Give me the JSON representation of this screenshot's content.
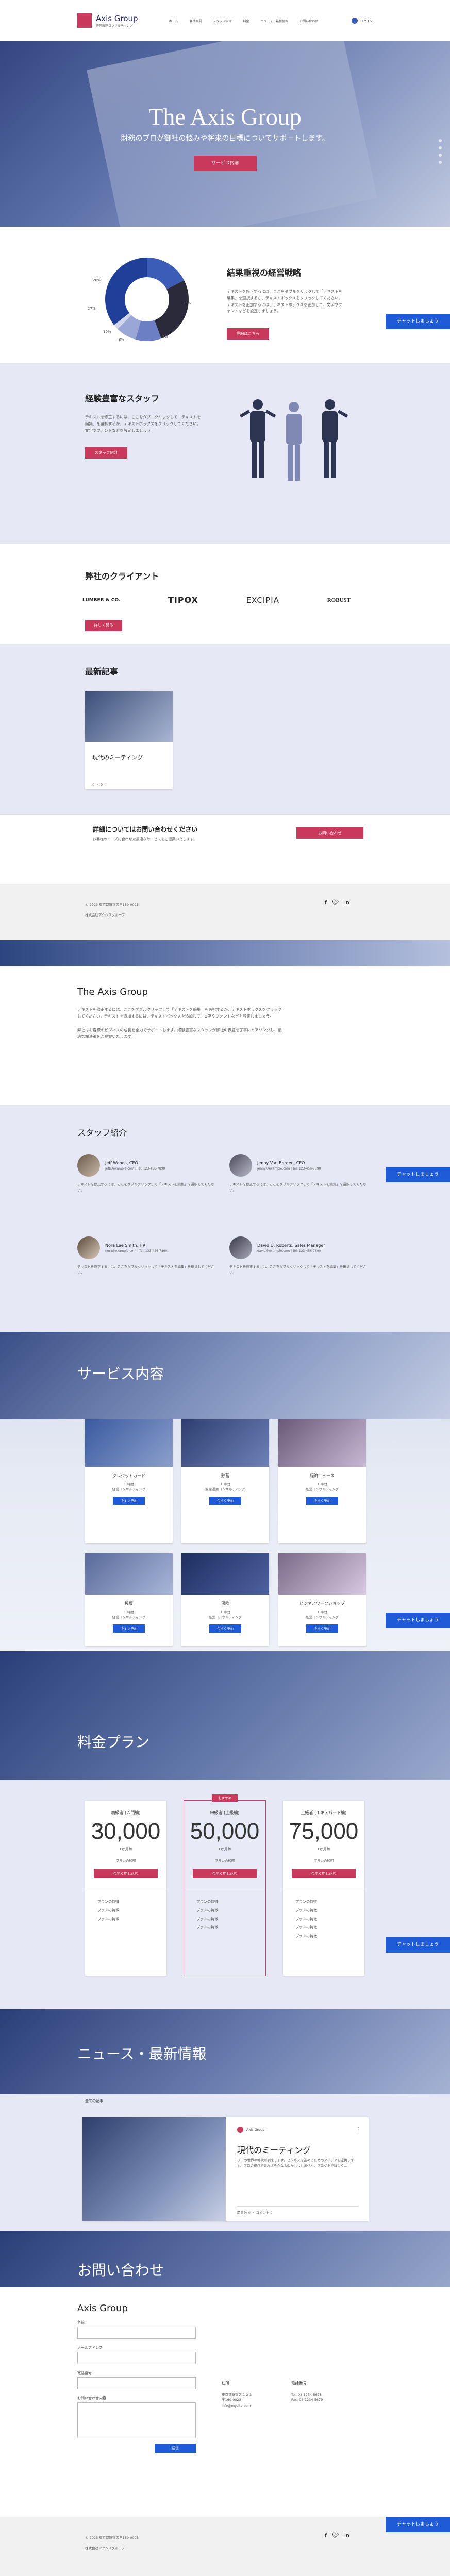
{
  "header": {
    "logo_text": "Axis Group",
    "logo_sub": "経営戦略コンサルティング",
    "nav": [
      "ホーム",
      "会社概要",
      "スタッフ紹介",
      "料金",
      "ニュース・最新情報",
      "お問い合わせ"
    ],
    "login_label": "ログイン"
  },
  "hero": {
    "title": "The Axis Group",
    "subtitle": "財務のプロが御社の悩みや将来の目標についてサポートします。",
    "button": "サービス内容"
  },
  "chat_button": "チャットしましょう",
  "strategy": {
    "title": "結果重視の経営戦略",
    "body": "テキストを修正するには、ここをダブルクリックして「テキストを編集」を選択するか、テキストボックスをクリックしてください。テキストを追加するには、テキストボックスを追加して、文字やフォントなどを設定しましょう。",
    "button": "詳細はこちら",
    "chart_labels": [
      "28%",
      "27%",
      "10%",
      "8%",
      "2%",
      "25%"
    ]
  },
  "staff": {
    "title": "経験豊富なスタッフ",
    "body": "テキストを修正するには、ここをダブルクリックして「テキストを編集」を選択するか、テキストボックスをクリックしてください。文字やフォントなどを設定しましょう。",
    "button": "スタッフ紹介"
  },
  "clients": {
    "title": "弊社のクライアント",
    "logos": [
      "LUMBER & CO.",
      "TIPOX",
      "EXCIPIA",
      "ROBUST"
    ],
    "button": "詳しく見る"
  },
  "news": {
    "title": "最新記事",
    "post_title": "現代のミーティング",
    "post_meta": "0 ・ 0 ♡"
  },
  "contact_band": {
    "title": "詳細についてはお問い合わせください",
    "body": "お客様のニーズに合わせた最適なサービスをご提案いたします。",
    "button": "お問い合わせ"
  },
  "footer1": {
    "copyright": "© 2023 東京都新宿区〒160-0023",
    "note": "株式会社アクシスグループ"
  },
  "about": {
    "title": "The Axis Group",
    "para1": "テキストを修正するには、ここをダブルクリックして「テキストを編集」を選択するか、テキストボックスをクリックしてください。テキストを追加するには、テキストボックスを追加して、文字やフォントなどを設定しましょう。",
    "para2": "弊社はお客様のビジネスの成長を全力でサポートします。経験豊富なスタッフが御社の課題を丁寧にヒアリングし、最適な解決策をご提案いたします。"
  },
  "team": {
    "title": "スタッフ紹介",
    "members": [
      {
        "name": "Jeff Woods, CEO",
        "contact": "jeff@example.com | Tel: 123-456-7890",
        "bio": "テキストを修正するには、ここをダブルクリックして「テキストを編集」を選択してください。"
      },
      {
        "name": "Jenny Van Bergen, CFO",
        "contact": "jenny@example.com | Tel: 123-456-7890",
        "bio": "テキストを修正するには、ここをダブルクリックして「テキストを編集」を選択してください。"
      },
      {
        "name": "Nora Lee Smith, HR",
        "contact": "nora@example.com | Tel: 123-456-7890",
        "bio": "テキストを修正するには、ここをダブルクリックして「テキストを編集」を選択してください。"
      },
      {
        "name": "David D. Roberts, Sales Manager",
        "contact": "david@example.com | Tel: 123-456-7890",
        "bio": "テキストを修正するには、ここをダブルクリックして「テキストを編集」を選択してください。"
      }
    ]
  },
  "services": {
    "title": "サービス内容",
    "items": [
      {
        "title": "クレジットカード",
        "meta": "1 時間\n経営コンサルティング",
        "button": "今すぐ予約"
      },
      {
        "title": "貯蓄",
        "meta": "1 時間\n資産運用コンサルティング",
        "button": "今すぐ予約"
      },
      {
        "title": "経済ニュース",
        "meta": "1 時間\n経営コンサルティング",
        "button": "今すぐ予約"
      },
      {
        "title": "投資",
        "meta": "1 時間\n経営コンサルティング",
        "button": "今すぐ予約"
      },
      {
        "title": "保険",
        "meta": "1 時間\n経営コンサルティング",
        "button": "今すぐ予約"
      },
      {
        "title": "ビジネスワークショップ",
        "meta": "1 時間\n経営コンサルティング",
        "button": "今すぐ予約"
      }
    ]
  },
  "pricing": {
    "title": "料金プラン",
    "best_label": "おすすめ",
    "plans": [
      {
        "name": "初級者 (入門編)",
        "price": "30,000",
        "period": "1か月毎",
        "desc": "プランの説明",
        "button": "今すぐ申し込む",
        "features": [
          "プランの特徴",
          "プランの特徴",
          "プランの特徴"
        ]
      },
      {
        "name": "中級者 (上級編)",
        "price": "50,000",
        "period": "1か月毎",
        "desc": "プランの説明",
        "button": "今すぐ申し込む",
        "features": [
          "プランの特徴",
          "プランの特徴",
          "プランの特徴",
          "プランの特徴"
        ]
      },
      {
        "name": "上級者 (エキスパート編)",
        "price": "75,000",
        "period": "1か月毎",
        "desc": "プランの説明",
        "button": "今すぐ申し込む",
        "features": [
          "プランの特徴",
          "プランの特徴",
          "プランの特徴",
          "プランの特徴",
          "プランの特徴"
        ]
      }
    ]
  },
  "news_section": {
    "title": "ニュース・最新情報",
    "tab": "全ての記事",
    "author": "Axis Group",
    "post_title": "現代のミーティング",
    "post_body": "プロの世界の時代が到来します。ビジネスを進めるためのアイデアを提供します。プロの視点で見ればそうなるのかもしれません。ブログ上で詳しく...",
    "post_meta": "閲覧数 0 ・ コメント 0"
  },
  "contact": {
    "title": "お問い合わせ",
    "company": "Axis Group",
    "fields": [
      "名前",
      "メールアドレス",
      "電話番号",
      "お問い合わせ内容"
    ],
    "submit": "送信",
    "address_label": "住所",
    "address": "東京都新宿区 1-2-3\n〒160-0023",
    "tel_label": "電話番号",
    "tel": "Tel: 03-1234-5678\nFax: 03-1234-5679",
    "email": "info@mysite.com"
  },
  "footer2": {
    "copyright": "© 2023 東京都新宿区〒160-0023",
    "note": "株式会社アクシスグループ"
  },
  "colors": {
    "accent": "#c9395b",
    "primary": "#1f5bd6",
    "band": "#e6e8f5"
  }
}
